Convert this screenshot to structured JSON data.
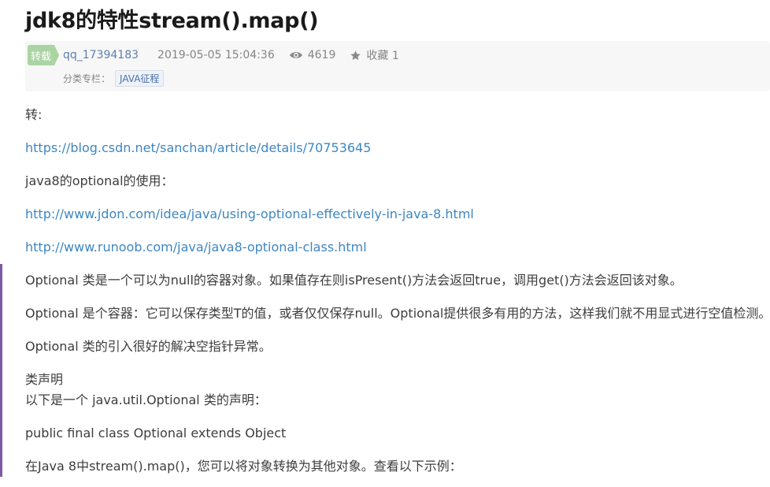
{
  "article": {
    "title": "jdk8的特性stream().map()",
    "badge": "转载",
    "author": "qq_17394183",
    "date": "2019-05-05 15:04:36",
    "views": "4619",
    "favorites": "收藏 1",
    "category_label": "分类专栏：",
    "category_tag": "JAVA征程"
  },
  "icons": {
    "views": "eye-icon",
    "favorites": "star-icon"
  },
  "body": {
    "p1": "转:",
    "link1": "https://blog.csdn.net/sanchan/article/details/70753645",
    "p2": "java8的optional的使用：",
    "link2": "http://www.jdon.com/idea/java/using-optional-effectively-in-java-8.html",
    "link3": "http://www.runoob.com/java/java8-optional-class.html",
    "p3": "Optional 类是一个可以为null的容器对象。如果值存在则isPresent()方法会返回true，调用get()方法会返回该对象。",
    "p4": "Optional 是个容器：它可以保存类型T的值，或者仅仅保存null。Optional提供很多有用的方法，这样我们就不用显式进行空值检测。",
    "p5": "Optional 类的引入很好的解决空指针异常。",
    "p6": "类声明",
    "p7": "以下是一个 java.util.Optional 类的声明：",
    "p8": "public final class Optional extends Object",
    "p9": "在Java 8中stream().map()，您可以将对象转换为其他对象。查看以下示例："
  },
  "colors": {
    "link": "#3e86c2",
    "badge": "#aad4a2",
    "author": "#5a7fb0"
  }
}
